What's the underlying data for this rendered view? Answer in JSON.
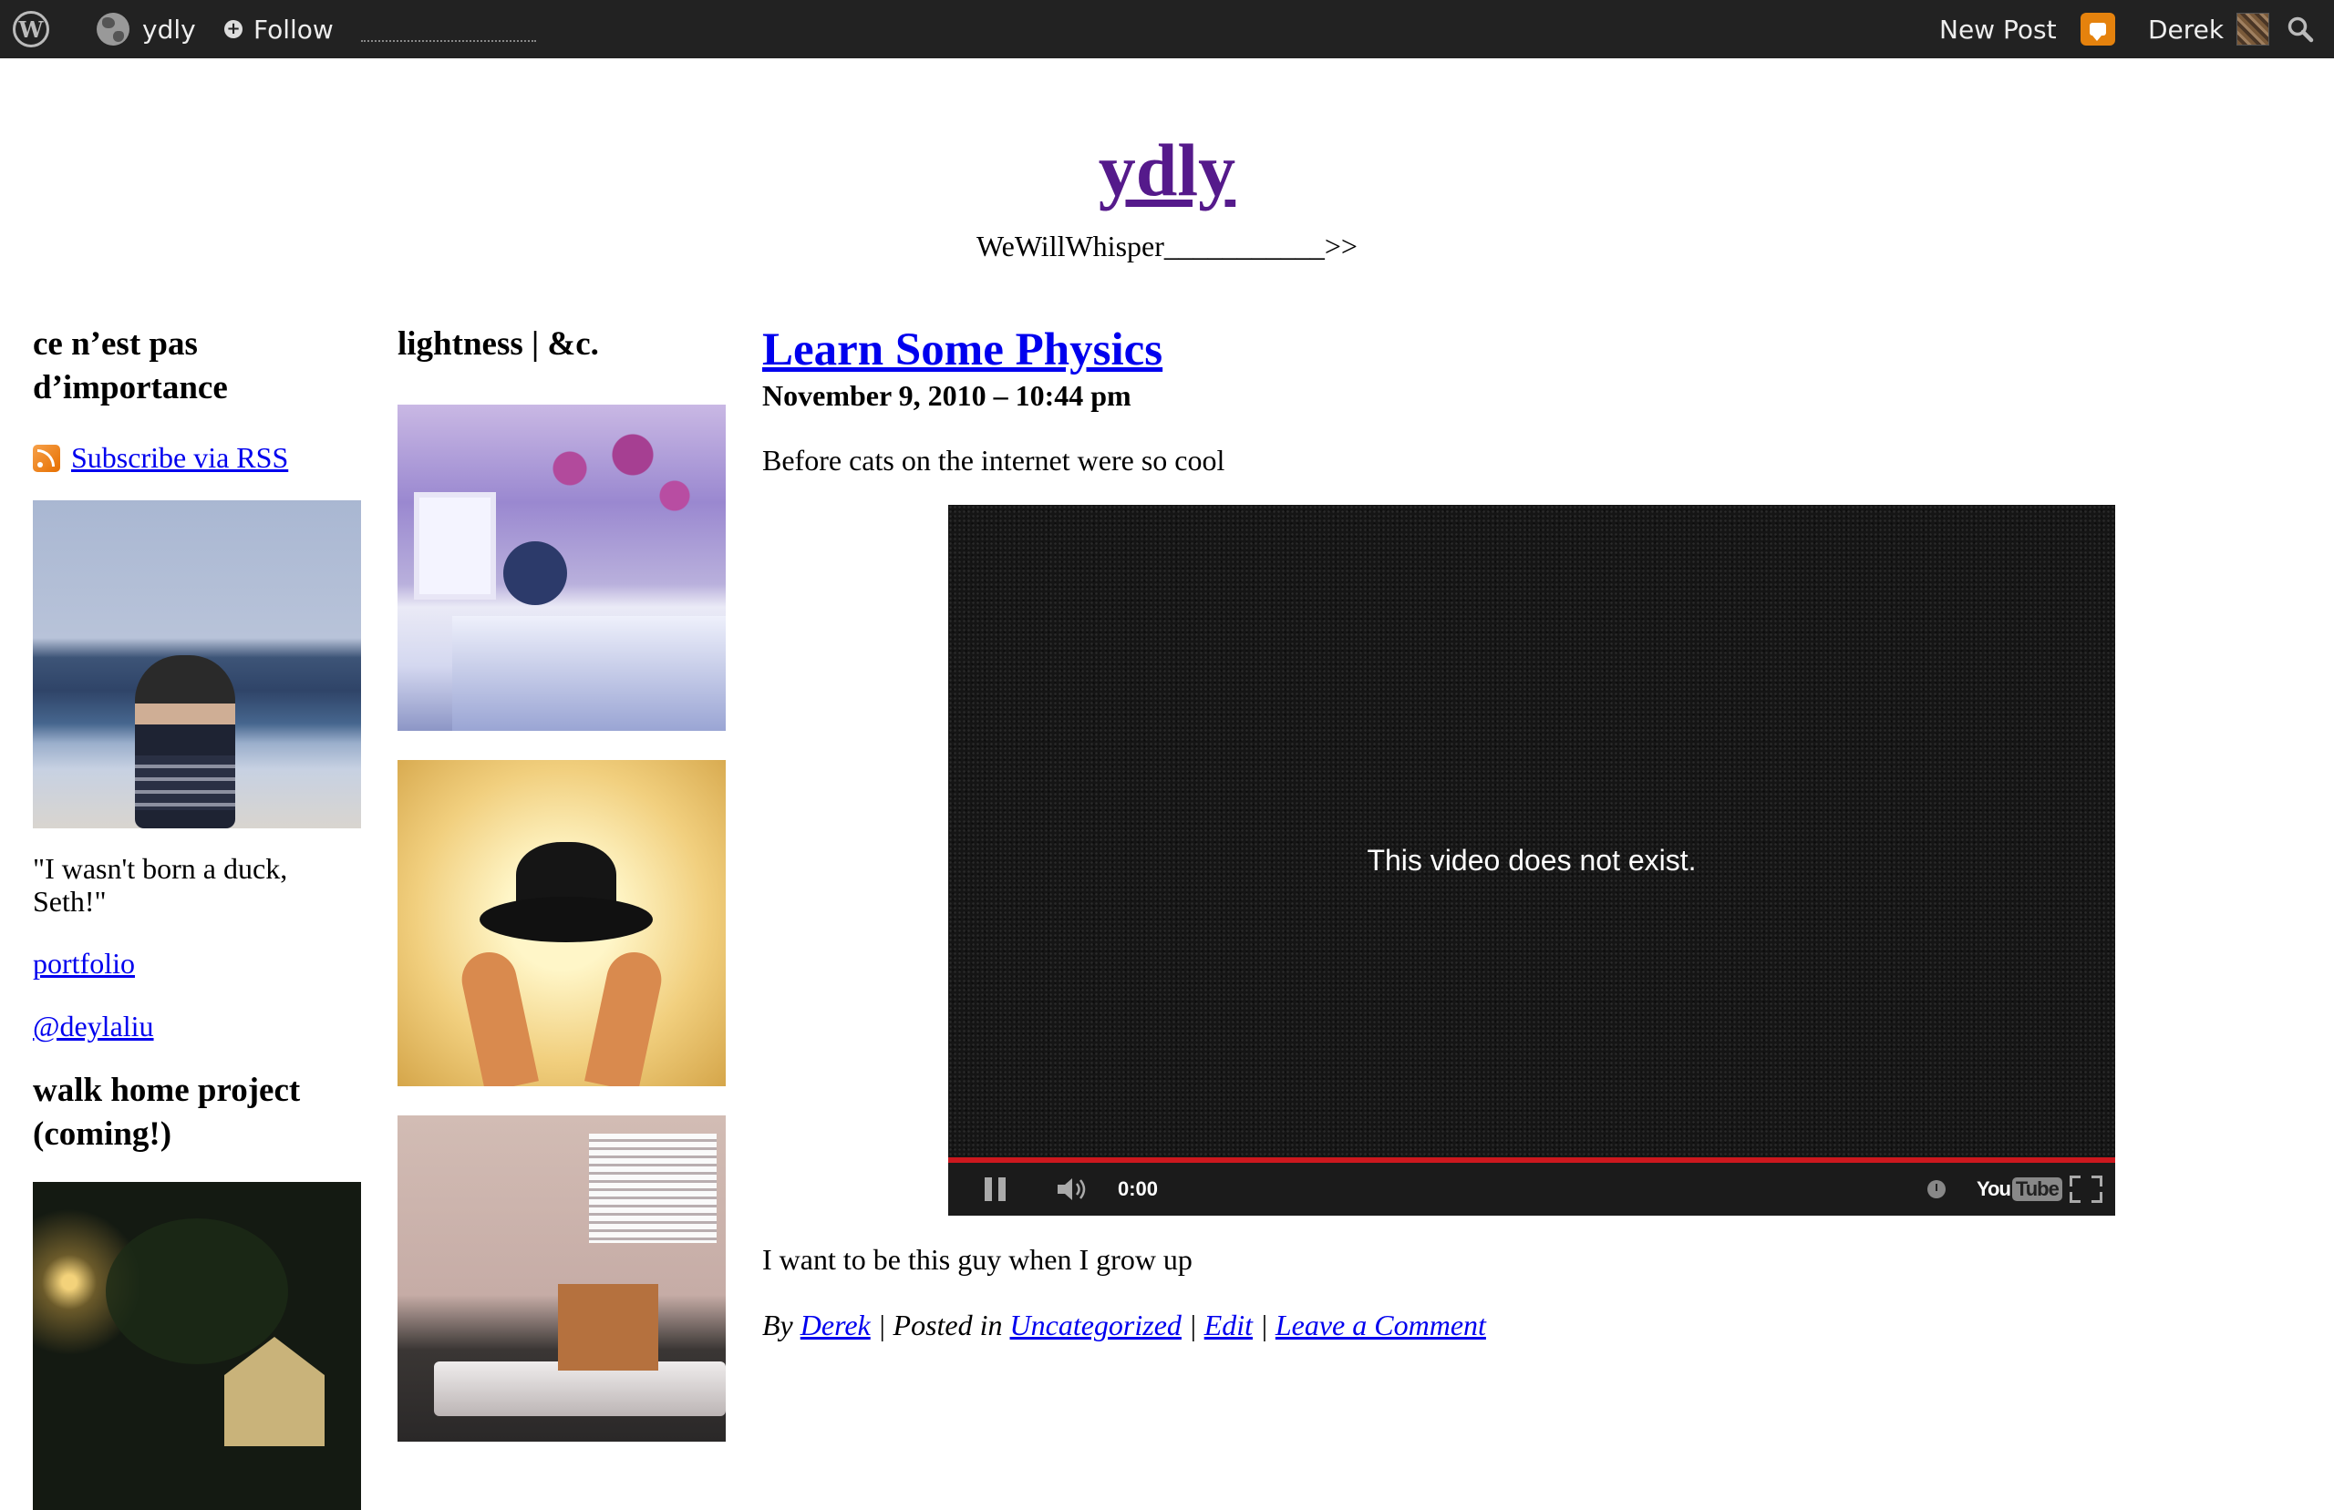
{
  "adminbar": {
    "site_name": "ydly",
    "follow_label": "Follow",
    "new_post_label": "New Post",
    "user_name": "Derek",
    "notification_color": "#e5820d",
    "icons": [
      "wordpress-logo-icon",
      "globe-icon",
      "plus-circle-icon",
      "notification-bubble-icon",
      "user-avatar",
      "search-icon"
    ]
  },
  "header": {
    "title": "ydly",
    "description": "WeWillWhisper___________>>"
  },
  "sidebar1": {
    "widget_title": "ce n’est pas d’importance",
    "rss_label": "Subscribe via RSS",
    "quote": "\"I wasn't born a duck, Seth!\"",
    "links": [
      "portfolio",
      "@deylaliu"
    ],
    "walk_title": "walk home project (coming!)"
  },
  "sidebar2": {
    "widget_title": "lightness | &c."
  },
  "post": {
    "title": "Learn Some Physics",
    "date": "November 9, 2010 – 10:44 pm",
    "intro": "Before cats on the internet were so cool",
    "video": {
      "message": "This video does not exist.",
      "time": "0:00",
      "progress_color": "#cc181e",
      "logo_you": "You",
      "logo_tube": "Tube"
    },
    "after_text": "I want to be this guy when I grow up",
    "meta": {
      "by": "By",
      "author": "Derek",
      "posted_in": "| Posted in",
      "category": "Uncategorized",
      "sep1": "|",
      "edit": "Edit",
      "sep2": "|",
      "comment": "Leave a Comment"
    }
  }
}
